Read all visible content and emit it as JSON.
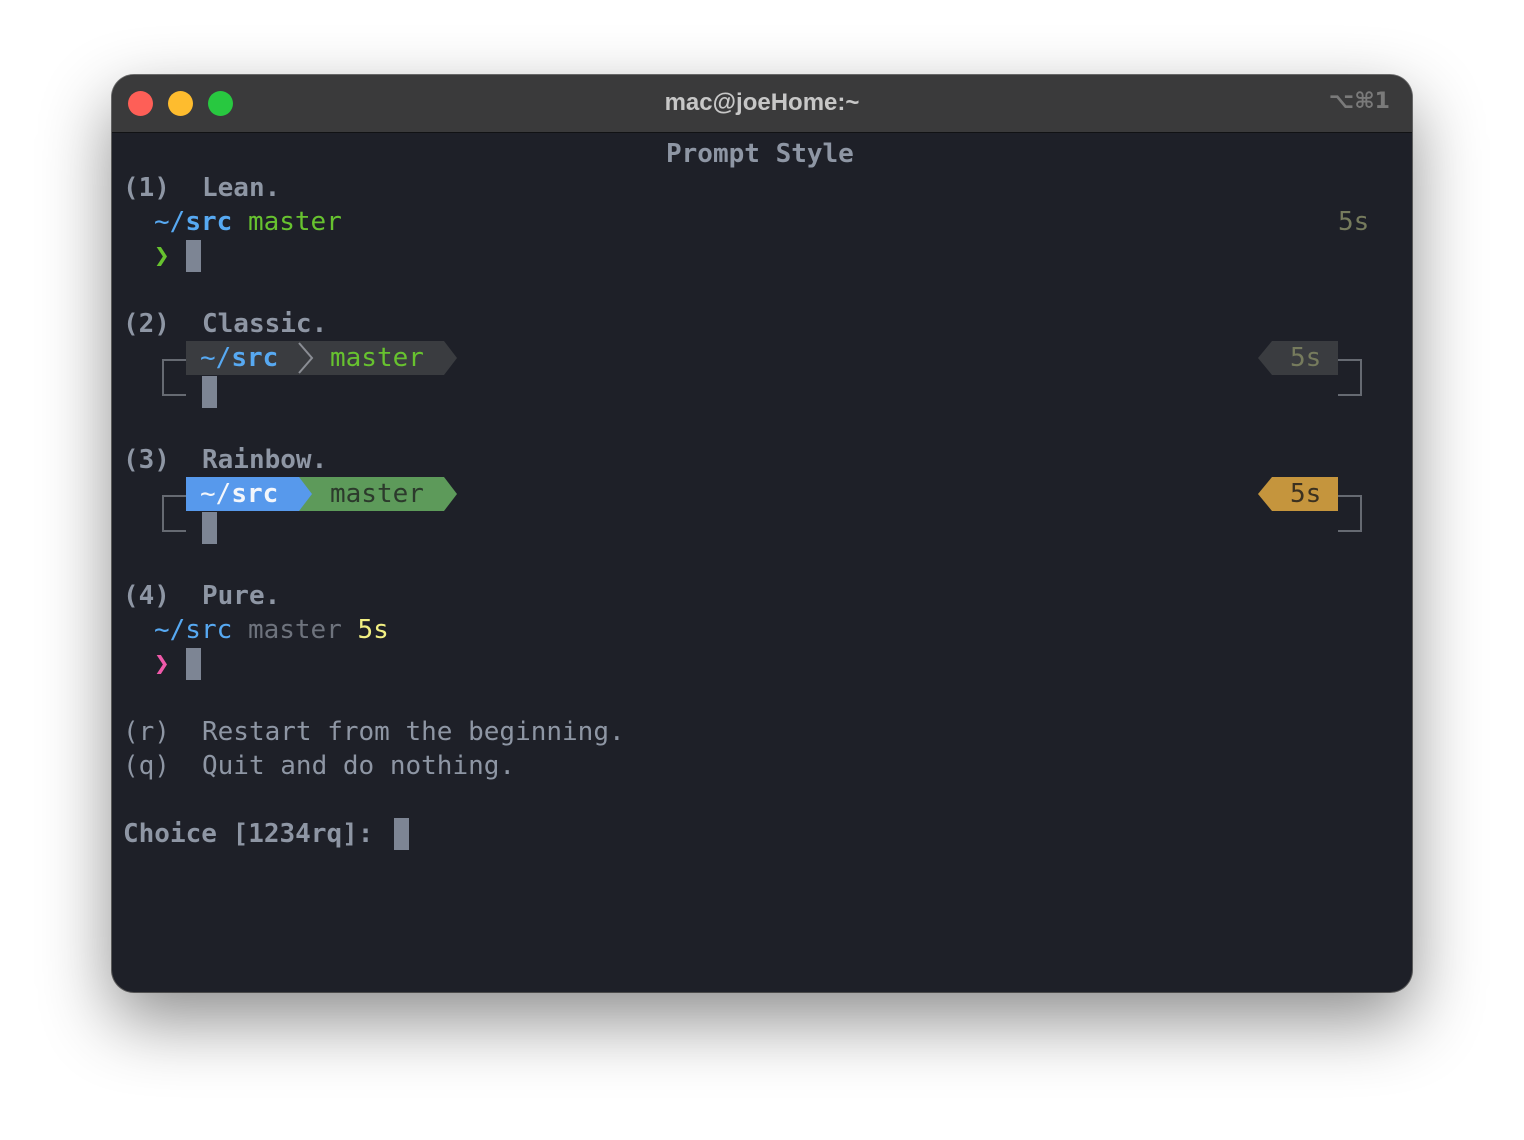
{
  "window": {
    "title": "mac@joeHome:~",
    "shortcut": "⌥⌘1"
  },
  "terminal": {
    "heading": "Prompt Style",
    "options": [
      {
        "key": "(1)",
        "name": "Lean.",
        "dir_prefix": "~/",
        "dir": "src",
        "branch": "master",
        "time": "5s",
        "prompt_char": "❯"
      },
      {
        "key": "(2)",
        "name": "Classic.",
        "dir_prefix": "~/",
        "dir": "src",
        "branch": "master",
        "time": "5s"
      },
      {
        "key": "(3)",
        "name": "Rainbow.",
        "dir_prefix": "~/",
        "dir": "src",
        "branch": "master",
        "time": "5s"
      },
      {
        "key": "(4)",
        "name": "Pure.",
        "dir": "~/src",
        "branch": "master",
        "time": "5s",
        "prompt_char": "❯"
      }
    ],
    "restart": {
      "key": "(r)",
      "label": "Restart from the beginning."
    },
    "quit": {
      "key": "(q)",
      "label": "Quit and do nothing."
    },
    "choice_prompt": "Choice [1234rq]: "
  },
  "colors": {
    "background": "#1e2028",
    "titlebar": "#3a3a3b",
    "dir_blue": "#57a9f2",
    "branch_green": "#67c22f",
    "rainbow_dir_bg": "#5799ec",
    "rainbow_branch_bg": "#5d9a5a",
    "rainbow_time_bg": "#c5953d",
    "classic_segment_bg": "#3a3c40",
    "pure_time_yellow": "#f2f083",
    "pure_prompt_pink": "#ef59a9"
  }
}
